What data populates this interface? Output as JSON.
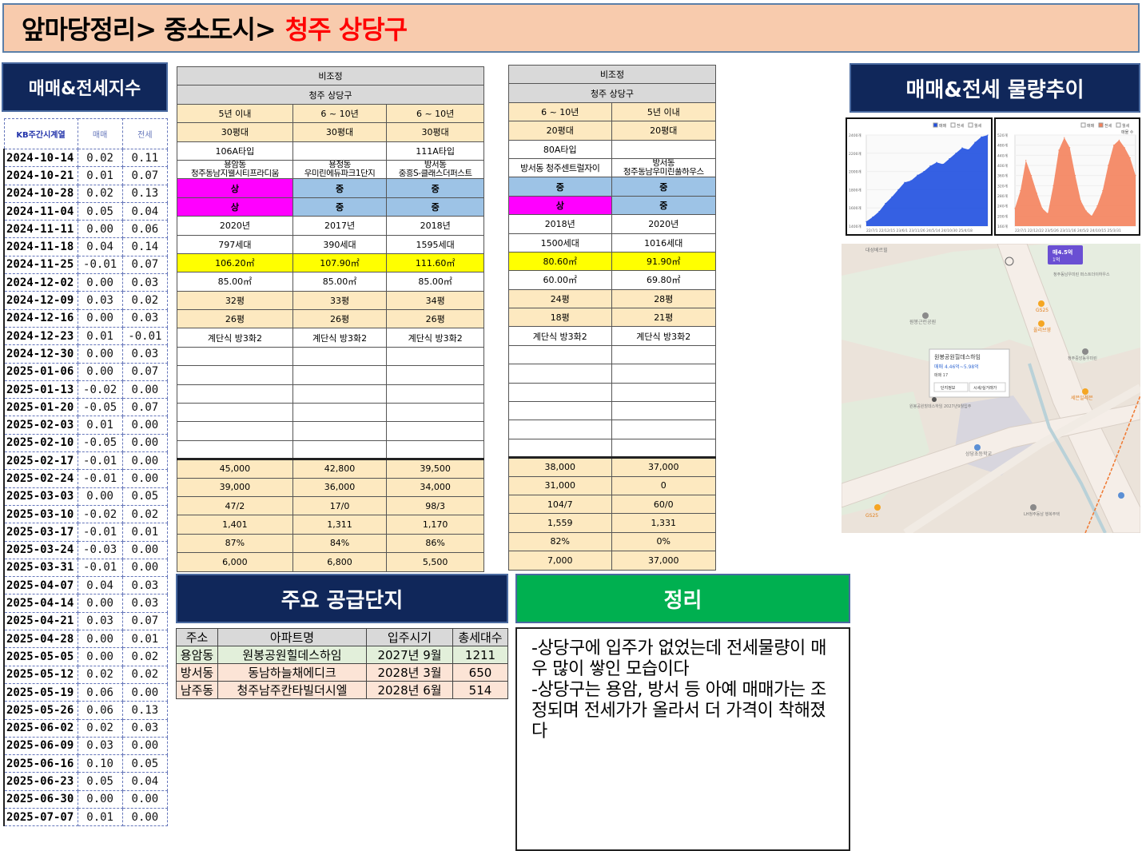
{
  "banner": {
    "prefix": "앞마당정리> 중소도시>",
    "highlight": "청주 상당구"
  },
  "kb": {
    "title": "매매&전세지수",
    "headers": [
      "KB주간시계열",
      "매매",
      "전세"
    ],
    "rows": [
      [
        "2024-10-14",
        "0.02",
        "0.11"
      ],
      [
        "2024-10-21",
        "0.01",
        "0.07"
      ],
      [
        "2024-10-28",
        "0.02",
        "0.13"
      ],
      [
        "2024-11-04",
        "0.05",
        "0.04"
      ],
      [
        "2024-11-11",
        "0.00",
        "0.06"
      ],
      [
        "2024-11-18",
        "0.04",
        "0.14"
      ],
      [
        "2024-11-25",
        "-0.01",
        "0.07"
      ],
      [
        "2024-12-02",
        "0.00",
        "0.03"
      ],
      [
        "2024-12-09",
        "0.03",
        "0.02"
      ],
      [
        "2024-12-16",
        "0.00",
        "0.03"
      ],
      [
        "2024-12-23",
        "0.01",
        "-0.01"
      ],
      [
        "2024-12-30",
        "0.00",
        "0.03"
      ],
      [
        "2025-01-06",
        "0.00",
        "0.07"
      ],
      [
        "2025-01-13",
        "-0.02",
        "0.00"
      ],
      [
        "2025-01-20",
        "-0.05",
        "0.07"
      ],
      [
        "2025-02-03",
        "0.01",
        "0.00"
      ],
      [
        "2025-02-10",
        "-0.05",
        "0.00"
      ],
      [
        "2025-02-17",
        "-0.01",
        "0.00"
      ],
      [
        "2025-02-24",
        "-0.01",
        "0.00"
      ],
      [
        "2025-03-03",
        "0.00",
        "0.05"
      ],
      [
        "2025-03-10",
        "-0.02",
        "0.02"
      ],
      [
        "2025-03-17",
        "-0.01",
        "0.01"
      ],
      [
        "2025-03-24",
        "-0.03",
        "0.00"
      ],
      [
        "2025-03-31",
        "-0.01",
        "0.00"
      ],
      [
        "2025-04-07",
        "0.04",
        "0.03"
      ],
      [
        "2025-04-14",
        "0.00",
        "0.03"
      ],
      [
        "2025-04-21",
        "0.03",
        "0.07"
      ],
      [
        "2025-04-28",
        "0.00",
        "0.01"
      ],
      [
        "2025-05-05",
        "0.00",
        "0.02"
      ],
      [
        "2025-05-12",
        "0.02",
        "0.02"
      ],
      [
        "2025-05-19",
        "0.06",
        "0.00"
      ],
      [
        "2025-05-26",
        "0.06",
        "0.13"
      ],
      [
        "2025-06-02",
        "0.02",
        "0.03"
      ],
      [
        "2025-06-09",
        "0.03",
        "0.00"
      ],
      [
        "2025-06-16",
        "0.10",
        "0.05"
      ],
      [
        "2025-06-23",
        "0.05",
        "0.04"
      ],
      [
        "2025-06-30",
        "0.00",
        "0.00"
      ],
      [
        "2025-07-07",
        "0.01",
        "0.00"
      ]
    ]
  },
  "compare1": {
    "header1": "비조정",
    "header2": "청주 상당구",
    "cols": [
      {
        "age": "5년 이내",
        "size": "30평대",
        "type": "106A타입",
        "dong": "용암동",
        "name": "청주동남지웰시티프라디움",
        "grade1": "상",
        "grade2": "상",
        "year": "2020년",
        "households": "797세대",
        "supply": "106.20㎡",
        "exclusive": "85.00㎡",
        "pyeong_supply": "32평",
        "pyeong_exclusive": "26평",
        "structure": "계단식 방3화2",
        "sale": "45,000",
        "jeonse": "39,000",
        "listings": "47/2",
        "price_per": "1,401",
        "ratio": "87%",
        "gap": "6,000"
      },
      {
        "age": "6 ~ 10년",
        "size": "30평대",
        "type": "",
        "dong": "용정동",
        "name": "우미린에듀파크1단지",
        "grade1": "중",
        "grade2": "중",
        "year": "2017년",
        "households": "390세대",
        "supply": "107.90㎡",
        "exclusive": "85.00㎡",
        "pyeong_supply": "33평",
        "pyeong_exclusive": "26평",
        "structure": "계단식 방3화2",
        "sale": "42,800",
        "jeonse": "36,000",
        "listings": "17/0",
        "price_per": "1,311",
        "ratio": "84%",
        "gap": "6,800"
      },
      {
        "age": "6 ~ 10년",
        "size": "30평대",
        "type": "111A타입",
        "dong": "방서동",
        "name": "중흥S-클래스더퍼스트",
        "grade1": "중",
        "grade2": "중",
        "year": "2018년",
        "households": "1595세대",
        "supply": "111.60㎡",
        "exclusive": "85.00㎡",
        "pyeong_supply": "34평",
        "pyeong_exclusive": "26평",
        "structure": "계단식 방3화2",
        "sale": "39,500",
        "jeonse": "34,000",
        "listings": "98/3",
        "price_per": "1,170",
        "ratio": "86%",
        "gap": "5,500"
      }
    ]
  },
  "compare2": {
    "header1": "비조정",
    "header2": "청주 상당구",
    "cols": [
      {
        "age": "6 ~ 10년",
        "size": "20평대",
        "type": "80A타입",
        "dong": "",
        "name": "방서동 청주센트럴자이",
        "grade1": "중",
        "grade2": "상",
        "year": "2018년",
        "households": "1500세대",
        "supply": "80.60㎡",
        "exclusive": "60.00㎡",
        "pyeong_supply": "24평",
        "pyeong_exclusive": "18평",
        "structure": "계단식 방3화2",
        "sale": "38,000",
        "jeonse": "31,000",
        "listings": "104/7",
        "price_per": "1,559",
        "ratio": "82%",
        "gap": "7,000"
      },
      {
        "age": "5년 이내",
        "size": "20평대",
        "type": "",
        "dong": "방서동",
        "name": "청주동남우미린풀하우스",
        "grade1": "중",
        "grade2": "중",
        "year": "2020년",
        "households": "1016세대",
        "supply": "91.90㎡",
        "exclusive": "69.80㎡",
        "pyeong_supply": "28평",
        "pyeong_exclusive": "21평",
        "structure": "계단식 방3화2",
        "sale": "37,000",
        "jeonse": "0",
        "listings": "60/0",
        "price_per": "1,331",
        "ratio": "0%",
        "gap": "37,000"
      }
    ]
  },
  "supply": {
    "title": "주요 공급단지",
    "headers": [
      "주소",
      "아파트명",
      "입주시기",
      "총세대수"
    ],
    "rows": [
      [
        "용암동",
        "원봉공원힐데스하임",
        "2027년 9월",
        "1211"
      ],
      [
        "방서동",
        "동남하늘채에디크",
        "2028년 3월",
        "650"
      ],
      [
        "남주동",
        "청주남주칸타빌더시엘",
        "2028년 6월",
        "514"
      ]
    ]
  },
  "summary": {
    "title": "정리",
    "lines": [
      "-상당구에 입주가 없었는데 전세물량이 매우 많이 쌓인 모습이다",
      "-상당구는 용암, 방서 등 아예 매매가는 조정되며 전세가가 올라서 더 가격이 착해졌다"
    ]
  },
  "volume": {
    "title": "매매&전세 물량추이",
    "legend1": [
      "매매",
      "전세",
      "월세"
    ],
    "legend2": [
      "매매",
      "전세",
      "월세"
    ],
    "legend2_extra": "매물 수",
    "colors": {
      "sale": "#1f4fe0",
      "jeonse": "#f4825c"
    },
    "y1_labels": [
      "2400개",
      "2200개",
      "2000개",
      "1800개",
      "1600개",
      "1400개"
    ],
    "y2_labels": [
      "520개",
      "480개",
      "440개",
      "400개",
      "360개",
      "320개",
      "280개",
      "240개",
      "200개",
      "160개"
    ],
    "x1_labels": "22/7/1 22/12/15 23/6/1 23/11/26 24/5/14 24/10/30 25/4/18",
    "x2_labels": "22/7/1 22/12/22 23/5/26 23/11/16 24/5/2 24/10/15 25/3/31",
    "chart_data": [
      {
        "type": "area",
        "series": [
          {
            "name": "매매",
            "values": [
              1450,
              1500,
              1560,
              1650,
              1720,
              1800,
              1880,
              1900,
              1960,
              2000,
              2060,
              2100,
              2080,
              2140,
              2200,
              2260,
              2240,
              2320,
              2380,
              2400
            ]
          }
        ]
      },
      {
        "type": "area",
        "series": [
          {
            "name": "전세",
            "values": [
              230,
              300,
              420,
              360,
              290,
              230,
              210,
              320,
              460,
              510,
              470,
              360,
              260,
              220,
              200,
              240,
              300,
              400,
              480,
              500,
              470,
              430,
              360
            ]
          }
        ]
      }
    ]
  },
  "map": {
    "popup_title": "원봉공원힐데스하임",
    "popup_price": "매매 4.46억~5.98억",
    "popup_count": "매매 17",
    "popup_btn1": "단지정보",
    "popup_btn2": "시세/실거래가",
    "marker_label": "매4.5억",
    "marker_sub": "1억",
    "pois": [
      "대성베르힐",
      "원봉근린공원",
      "원봉공원힐데스하임 2027년9월입주",
      "상당초등학교",
      "청주중앙동우미린",
      "세븐일레븐",
      "LH청주동남 행복주택",
      "GS25",
      "올리브영",
      "청주동남우미린 퍼스트더이하우스",
      "GS25"
    ]
  }
}
